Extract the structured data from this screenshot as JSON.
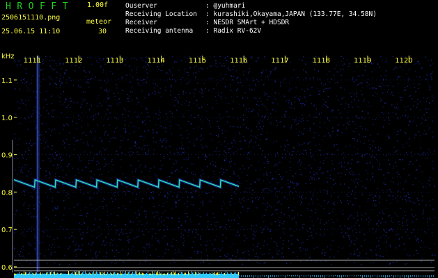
{
  "header": {
    "brand": "HROFFT",
    "version": "1.00f",
    "filename": "2506151110.png",
    "datetime": "25.06.15 11:10",
    "mode": "meteor",
    "count": "30"
  },
  "station": [
    {
      "key": "Ouserver",
      "sep": ":",
      "value": "@yuhmari"
    },
    {
      "key": "Receiving Location",
      "sep": ":",
      "value": "kurashiki,Okayama,JAPAN (133.77E, 34.58N)"
    },
    {
      "key": "Receiver",
      "sep": ":",
      "value": "NESDR SMArt + HDSDR"
    },
    {
      "key": "Receiving antenna",
      "sep": ":",
      "value": "Radix RV-62V"
    }
  ],
  "spectrogram": {
    "y_unit": "kHz",
    "x_ticks": [
      "1111",
      "1112",
      "1113",
      "1114",
      "1115",
      "1116",
      "1117",
      "1118",
      "1119",
      "1120"
    ],
    "y_ticks": [
      "1.1",
      "1.0",
      "0.9",
      "0.8",
      "0.7",
      "0.6"
    ],
    "y_tick_values": [
      1.1,
      1.0,
      0.9,
      0.8,
      0.7,
      0.6
    ],
    "y_range": [
      0.585,
      1.165
    ],
    "x_range": [
      1110.43,
      1120.62
    ],
    "colors": {
      "background": "#000000",
      "noise": "#1a2ca0",
      "trace": "#30e0a0",
      "axis_text": "#ffff40",
      "gridline": "#c8c8c8",
      "bottom_band": "#30c8ff",
      "bottom_spikes": "#ffff40"
    },
    "trace": {
      "start_min": 1110.43,
      "end_min": 1115.88,
      "freq_khz": 0.823,
      "sawtooth_period_min": 0.5
    }
  }
}
